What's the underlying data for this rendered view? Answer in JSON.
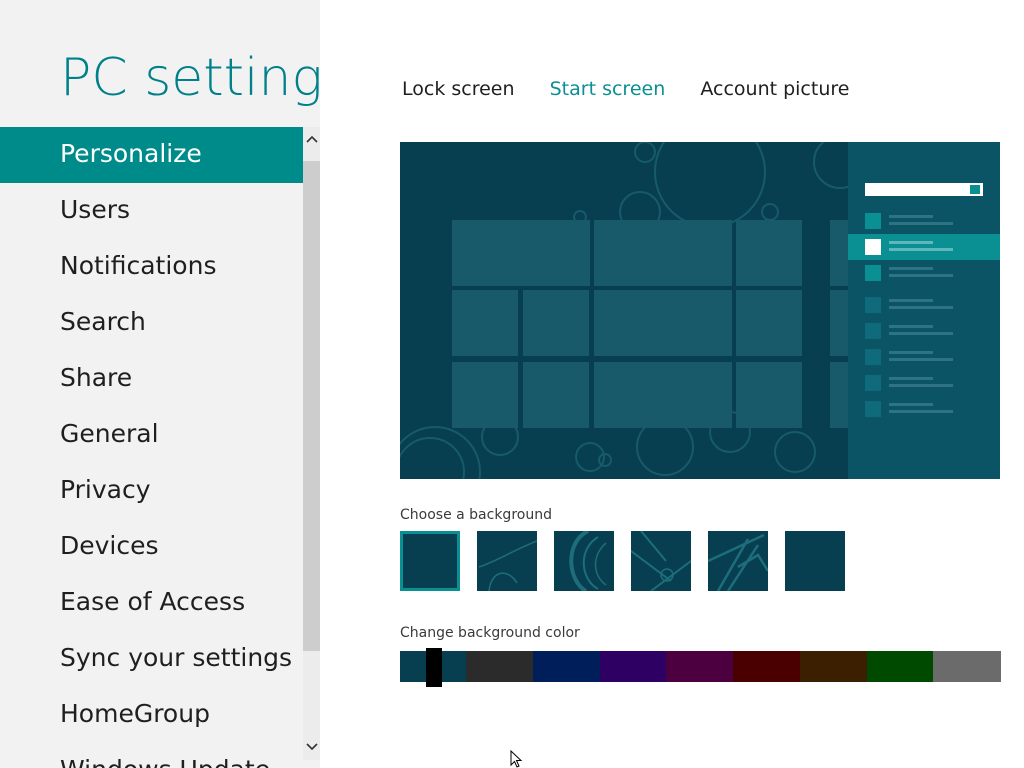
{
  "app": {
    "title": "PC settings"
  },
  "nav": {
    "items": [
      {
        "label": "Personalize",
        "active": true
      },
      {
        "label": "Users"
      },
      {
        "label": "Notifications"
      },
      {
        "label": "Search"
      },
      {
        "label": "Share"
      },
      {
        "label": "General"
      },
      {
        "label": "Privacy"
      },
      {
        "label": "Devices"
      },
      {
        "label": "Ease of Access"
      },
      {
        "label": "Sync your settings"
      },
      {
        "label": "HomeGroup"
      },
      {
        "label": "Windows Update"
      }
    ]
  },
  "tabs": [
    {
      "label": "Lock screen"
    },
    {
      "label": "Start screen",
      "active": true
    },
    {
      "label": "Account picture"
    }
  ],
  "sections": {
    "background_label": "Choose a background",
    "color_label": "Change background color"
  },
  "backgrounds": {
    "count": 6,
    "selected_index": 0
  },
  "colors": {
    "swatches": [
      "#073f50",
      "#2b2b2b",
      "#001f5a",
      "#2e0063",
      "#4d0040",
      "#4a0000",
      "#3b1f00",
      "#004a00",
      "#6b6b6b"
    ],
    "selected": "#073f50",
    "accent": "#0a8f93"
  },
  "icons": {
    "scroll_up": "chevron-up-icon",
    "scroll_down": "chevron-down-icon",
    "cursor": "mouse-pointer-icon"
  }
}
